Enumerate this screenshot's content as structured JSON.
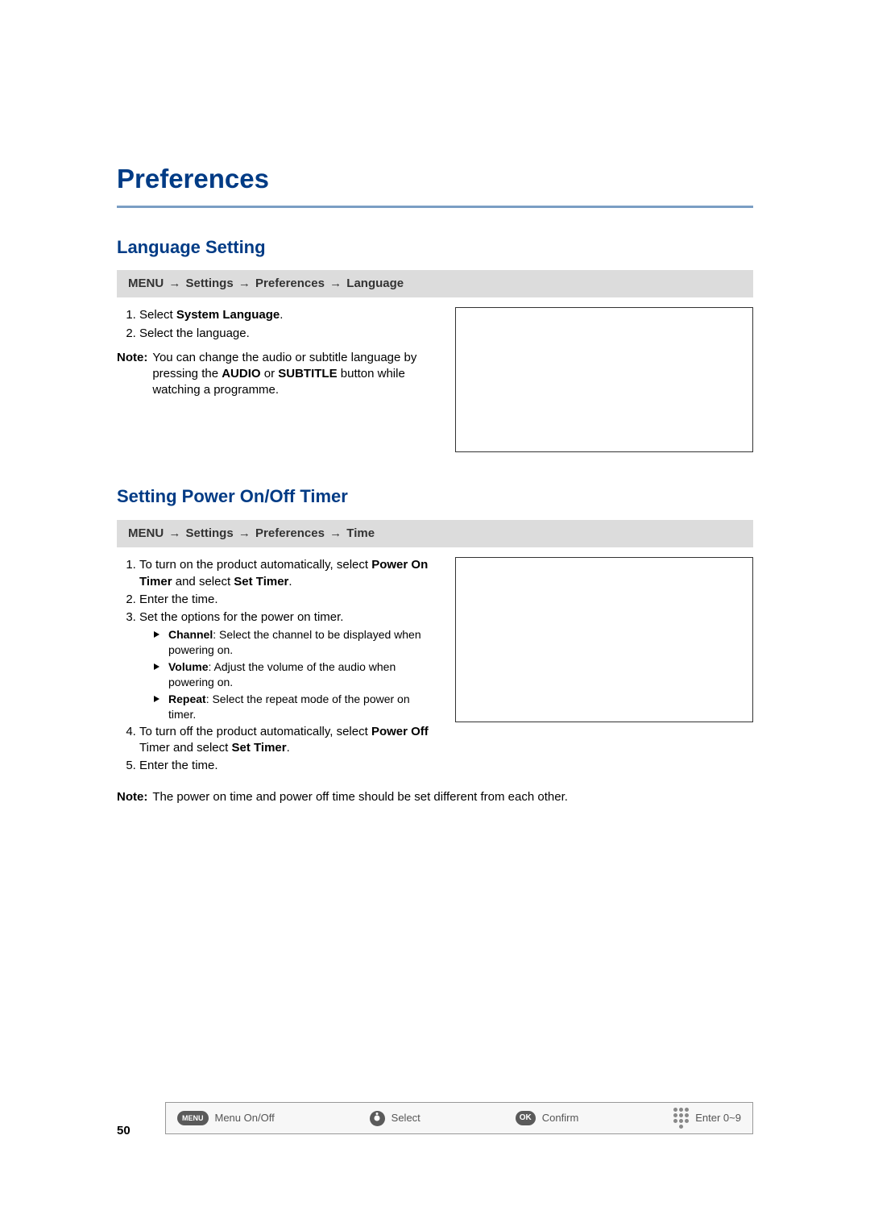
{
  "page_title": "Preferences",
  "section1": {
    "title": "Language Setting",
    "breadcrumb": {
      "parts": [
        "MENU",
        "Settings",
        "Preferences",
        "Language"
      ]
    },
    "step1_prefix": "Select ",
    "step1_bold": "System Language",
    "step1_suffix": ".",
    "step2": "Select the language.",
    "note_label": "Note:",
    "note_text_1": "You can change the audio or subtitle language by pressing the ",
    "note_bold1": "AUDIO",
    "note_text_2": " or ",
    "note_bold2": "SUBTITLE",
    "note_text_3": " button while watching a programme."
  },
  "section2": {
    "title": "Setting Power On/Off Timer",
    "breadcrumb": {
      "parts": [
        "MENU",
        "Settings",
        "Preferences",
        "Time"
      ]
    },
    "step1_prefix": "To turn on the product automatically, select ",
    "step1_bold1": "Power On Timer",
    "step1_mid": " and select ",
    "step1_bold2": "Set Timer",
    "step1_suffix": ".",
    "step2": "Enter the time.",
    "step3": "Set the options for the power on timer.",
    "bullets": {
      "b1_bold": "Channel",
      "b1_rest": ": Select the channel to be displayed when powering on.",
      "b2_bold": "Volume",
      "b2_rest": ": Adjust the volume of the audio when powering on.",
      "b3_bold": "Repeat",
      "b3_rest": ": Select the repeat mode of the power on timer."
    },
    "step4_prefix": "To turn off the product automatically, select ",
    "step4_bold1": "Power Off",
    "step4_mid": " Timer and select ",
    "step4_bold2": "Set Timer",
    "step4_suffix": ".",
    "step5": "Enter the time.",
    "note_label": "Note:",
    "note_text": "The power on time and power off time should be set different from each other."
  },
  "footer": {
    "page_number": "50",
    "menu": "Menu On/Off",
    "select": "Select",
    "confirm": "Confirm",
    "enter": "Enter 0~9",
    "ok": "OK",
    "menu_label": "MENU"
  }
}
